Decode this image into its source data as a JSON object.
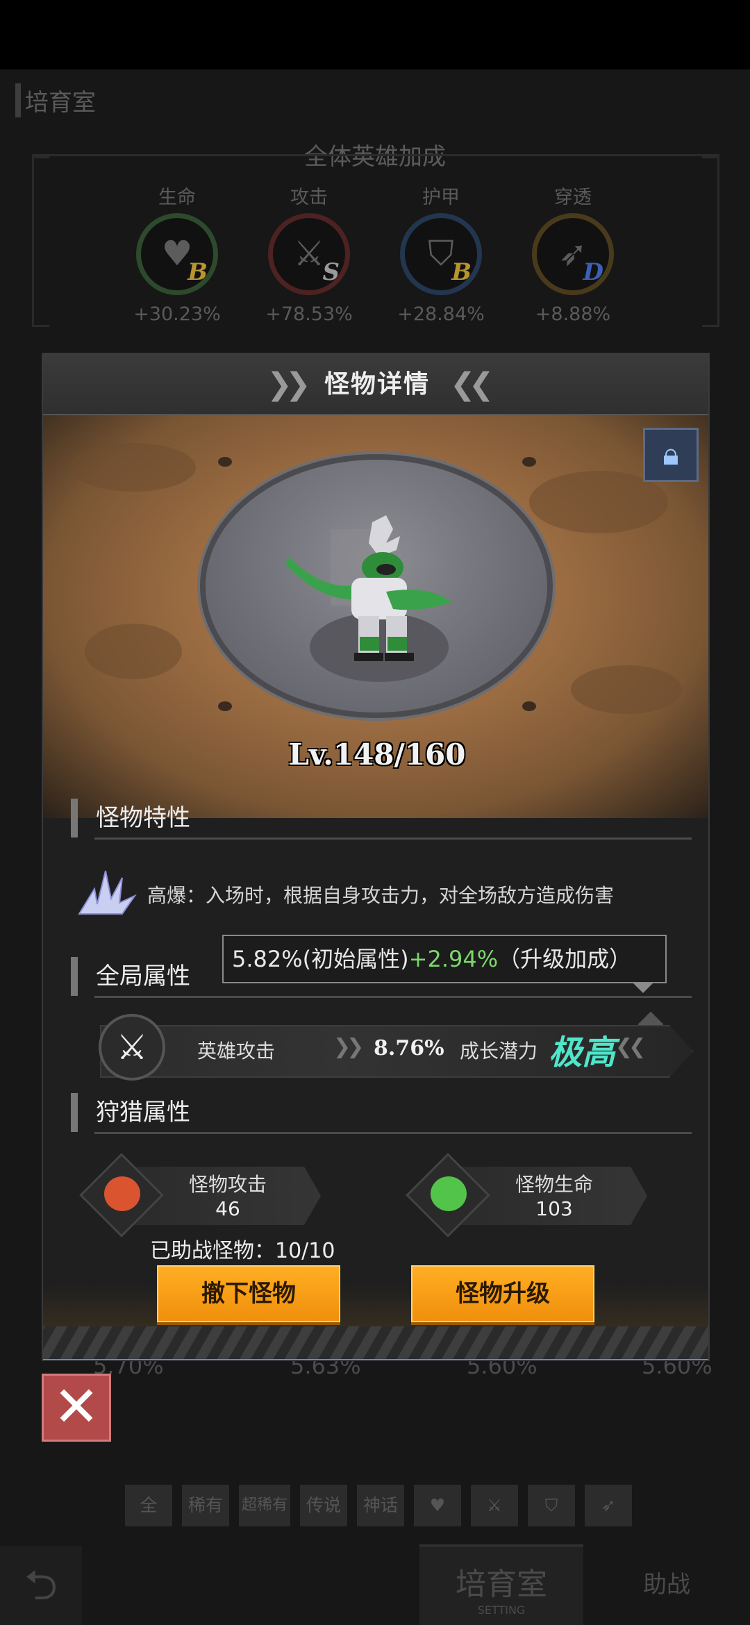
{
  "background": {
    "page_title": "培育室",
    "bonus_title": "全体英雄加成",
    "stats": [
      {
        "label": "生命",
        "value": "+30.23%",
        "grade": "B",
        "icon": "heart-icon",
        "glyph": "♥",
        "grade_color": "#b8952e"
      },
      {
        "label": "攻击",
        "value": "+78.53%",
        "grade": "S",
        "icon": "sword-icon",
        "glyph": "⚔",
        "grade_color": "#b8b8b8"
      },
      {
        "label": "护甲",
        "value": "+28.84%",
        "grade": "B",
        "icon": "shield-icon",
        "glyph": "⛉",
        "grade_color": "#b8952e"
      },
      {
        "label": "穿透",
        "value": "+8.88%",
        "grade": "D",
        "icon": "pierce-icon",
        "glyph": "➶",
        "grade_color": "#3b5fb5"
      }
    ],
    "list_values": [
      "5.70%",
      "5.63%",
      "5.60%",
      "5.60%"
    ],
    "filters": [
      "全",
      "稀有",
      "超稀有",
      "传说",
      "神话"
    ],
    "filter_icons": [
      "heart-icon",
      "sword-icon",
      "shield-icon",
      "pierce-icon"
    ],
    "bottom_tabs": {
      "active": "培育室",
      "active_sub": "SETTING",
      "other": "助战"
    }
  },
  "modal": {
    "title": "怪物详情",
    "level": "Lv.148/160",
    "lock_icon": "lock-icon",
    "trait_section": "怪物特性",
    "trait_text": "高爆：入场时，根据自身攻击力，对全场敌方造成伤害",
    "global_section": "全局属性",
    "tooltip": {
      "base": "5.82%(初始属性)",
      "bonus": "+2.94%",
      "bonus_label": "（升级加成）"
    },
    "global_attr": {
      "name": "英雄攻击",
      "value": "8.76%",
      "growth_label": "成长潜力",
      "growth_value": "极高"
    },
    "hunt_section": "狩猎属性",
    "hunt": [
      {
        "name": "怪物攻击",
        "value": "46",
        "icon": "monster-attack-icon",
        "color": "#d9542f"
      },
      {
        "name": "怪物生命",
        "value": "103",
        "icon": "monster-life-icon",
        "color": "#52c44a"
      }
    ],
    "assist": "已助战怪物：10/10",
    "buttons": {
      "remove": "撤下怪物",
      "upgrade": "怪物升级"
    }
  },
  "colors": {
    "accent_orange": "#f39a12",
    "growth_teal": "#4fe6c9",
    "bonus_green": "#7cd86a"
  }
}
